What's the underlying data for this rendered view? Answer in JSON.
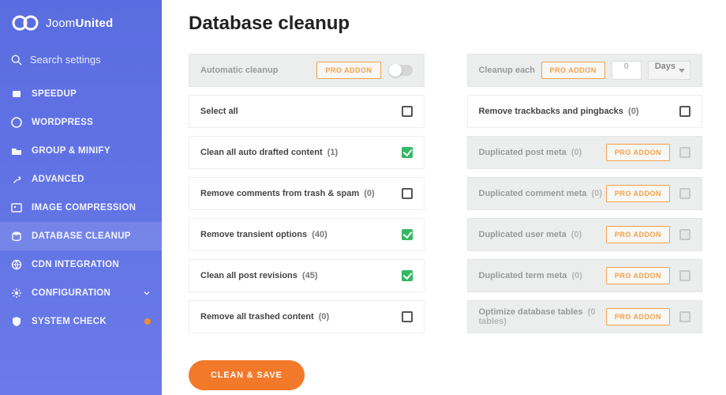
{
  "brand": {
    "name_light": "Joom",
    "name_bold": "United"
  },
  "search": {
    "placeholder": "Search settings"
  },
  "nav": [
    {
      "label": "SPEEDUP"
    },
    {
      "label": "WORDPRESS"
    },
    {
      "label": "GROUP & MINIFY"
    },
    {
      "label": "ADVANCED"
    },
    {
      "label": "IMAGE COMPRESSION"
    },
    {
      "label": "DATABASE CLEANUP"
    },
    {
      "label": "CDN INTEGRATION"
    },
    {
      "label": "CONFIGURATION"
    },
    {
      "label": "SYSTEM CHECK"
    }
  ],
  "page": {
    "title": "Database cleanup"
  },
  "auto_cleanup": {
    "label": "Automatic cleanup",
    "badge": "PRO ADDON"
  },
  "cleanup_each": {
    "label": "Cleanup each",
    "badge": "PRO ADDON",
    "value": "0",
    "unit": "Days"
  },
  "left": {
    "select_all": {
      "label": "Select all",
      "checked": false
    },
    "items": [
      {
        "label": "Clean all auto drafted content",
        "count": "(1)",
        "checked": true
      },
      {
        "label": "Remove comments from trash & spam",
        "count": "(0)",
        "checked": false
      },
      {
        "label": "Remove transient options",
        "count": "(40)",
        "checked": true
      },
      {
        "label": "Clean all post revisions",
        "count": "(45)",
        "checked": true
      },
      {
        "label": "Remove all trashed content",
        "count": "(0)",
        "checked": false
      }
    ]
  },
  "right": {
    "first": {
      "label": "Remove trackbacks and pingbacks",
      "count": "(0)",
      "checked": false
    },
    "pro_items": [
      {
        "label": "Duplicated post meta",
        "count": "(0)",
        "badge": "PRO ADDON"
      },
      {
        "label": "Duplicated comment meta",
        "count": "(0)",
        "badge": "PRO ADDON"
      },
      {
        "label": "Duplicated user meta",
        "count": "(0)",
        "badge": "PRO ADDON"
      },
      {
        "label": "Duplicated term meta",
        "count": "(0)",
        "badge": "PRO ADDON"
      },
      {
        "label": "Optimize database tables",
        "count": "(0 tables)",
        "badge": "PRO ADDON"
      }
    ]
  },
  "button": {
    "save": "CLEAN & SAVE"
  }
}
